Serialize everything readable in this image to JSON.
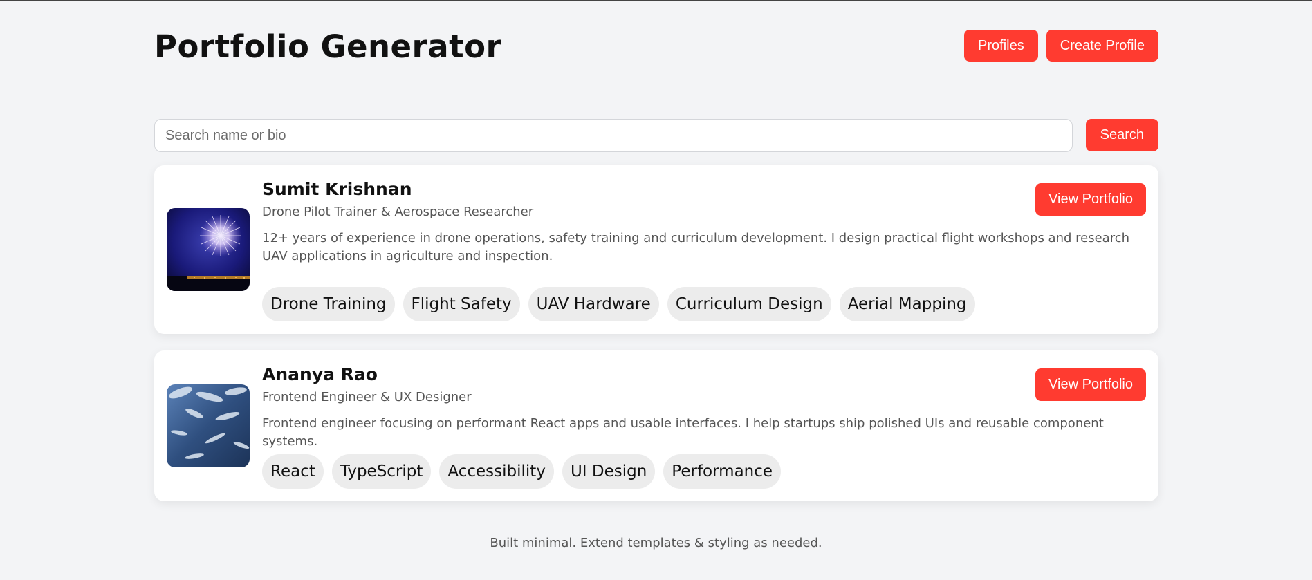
{
  "header": {
    "title": "Portfolio Generator",
    "nav": {
      "profiles_label": "Profiles",
      "create_label": "Create Profile"
    }
  },
  "search": {
    "placeholder": "Search name or bio",
    "value": "",
    "button_label": "Search"
  },
  "profiles": [
    {
      "name": "Sumit Krishnan",
      "role": "Drone Pilot Trainer & Aerospace Researcher",
      "bio": "12+ years of experience in drone operations, safety training and curriculum development. I design practical flight workshops and research UAV applications in agriculture and inspection.",
      "button_label": "View Portfolio",
      "tags": [
        "Drone Training",
        "Flight Safety",
        "UAV Hardware",
        "Curriculum Design",
        "Aerial Mapping"
      ],
      "avatar_icon": "fireworks-photo"
    },
    {
      "name": "Ananya Rao",
      "role": "Frontend Engineer & UX Designer",
      "bio": "Frontend engineer focusing on performant React apps and usable interfaces. I help startups ship polished UIs and reusable component systems.",
      "button_label": "View Portfolio",
      "tags": [
        "React",
        "TypeScript",
        "Accessibility",
        "UI Design",
        "Performance"
      ],
      "avatar_icon": "water-photo"
    }
  ],
  "footer": {
    "text": "Built minimal. Extend templates & styling as needed."
  },
  "colors": {
    "accent": "#ff3b30",
    "background": "#f3f4f6",
    "card": "#ffffff",
    "tag_bg": "#ececec"
  }
}
